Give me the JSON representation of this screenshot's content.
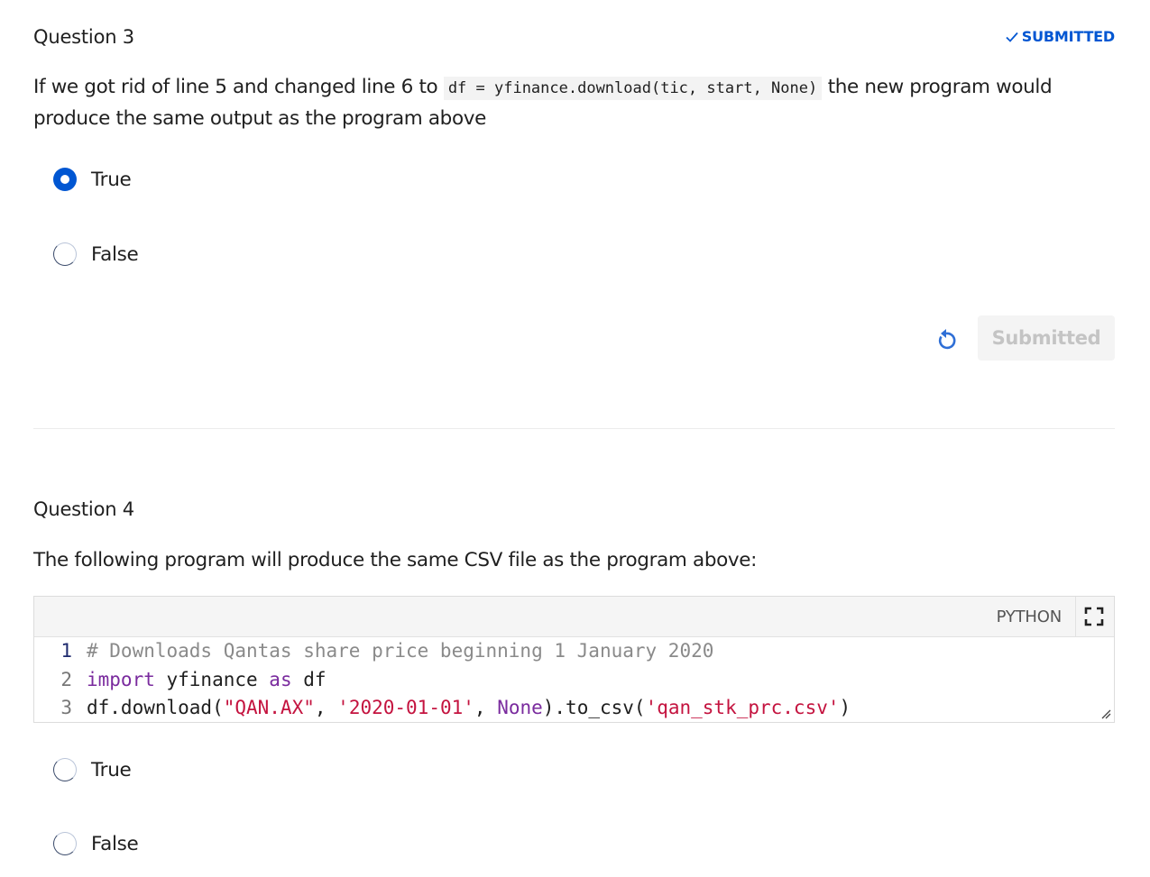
{
  "question3": {
    "title": "Question 3",
    "badge": "SUBMITTED",
    "prompt_before": "If we got rid of line 5 and changed line 6 to ",
    "prompt_code": "df = yfinance.download(tic, start, None)",
    "prompt_after": " the new program would produce the same output as the program above",
    "options": [
      {
        "label": "True",
        "selected": true
      },
      {
        "label": "False",
        "selected": false
      }
    ],
    "submit_label": "Submitted"
  },
  "question4": {
    "title": "Question 4",
    "prompt": "The following program will produce the same CSV file as the program above:",
    "code": {
      "language": "PYTHON",
      "lines": [
        {
          "num": "1",
          "tokens": [
            {
              "t": "comment",
              "v": "# Downloads Qantas share price beginning 1 January 2020"
            }
          ]
        },
        {
          "num": "2",
          "tokens": [
            {
              "t": "kw",
              "v": "import"
            },
            {
              "t": "plain",
              "v": " yfinance "
            },
            {
              "t": "kw",
              "v": "as"
            },
            {
              "t": "plain",
              "v": " df"
            }
          ]
        },
        {
          "num": "3",
          "tokens": [
            {
              "t": "plain",
              "v": "df.download("
            },
            {
              "t": "str",
              "v": "\"QAN.AX\""
            },
            {
              "t": "plain",
              "v": ", "
            },
            {
              "t": "str",
              "v": "'2020-01-01'"
            },
            {
              "t": "plain",
              "v": ", "
            },
            {
              "t": "kw",
              "v": "None"
            },
            {
              "t": "plain",
              "v": ").to_csv("
            },
            {
              "t": "str",
              "v": "'qan_stk_prc.csv'"
            },
            {
              "t": "plain",
              "v": ")"
            }
          ]
        }
      ]
    },
    "options": [
      {
        "label": "True",
        "selected": false
      },
      {
        "label": "False",
        "selected": false
      }
    ]
  },
  "colors": {
    "accent": "#0056d2",
    "keyword": "#7a2b9e",
    "string": "#c4133f",
    "comment": "#8a8a8a"
  },
  "icons": {
    "badge": "checkmark-icon",
    "reset": "reset-icon",
    "fullscreen": "fullscreen-icon"
  }
}
